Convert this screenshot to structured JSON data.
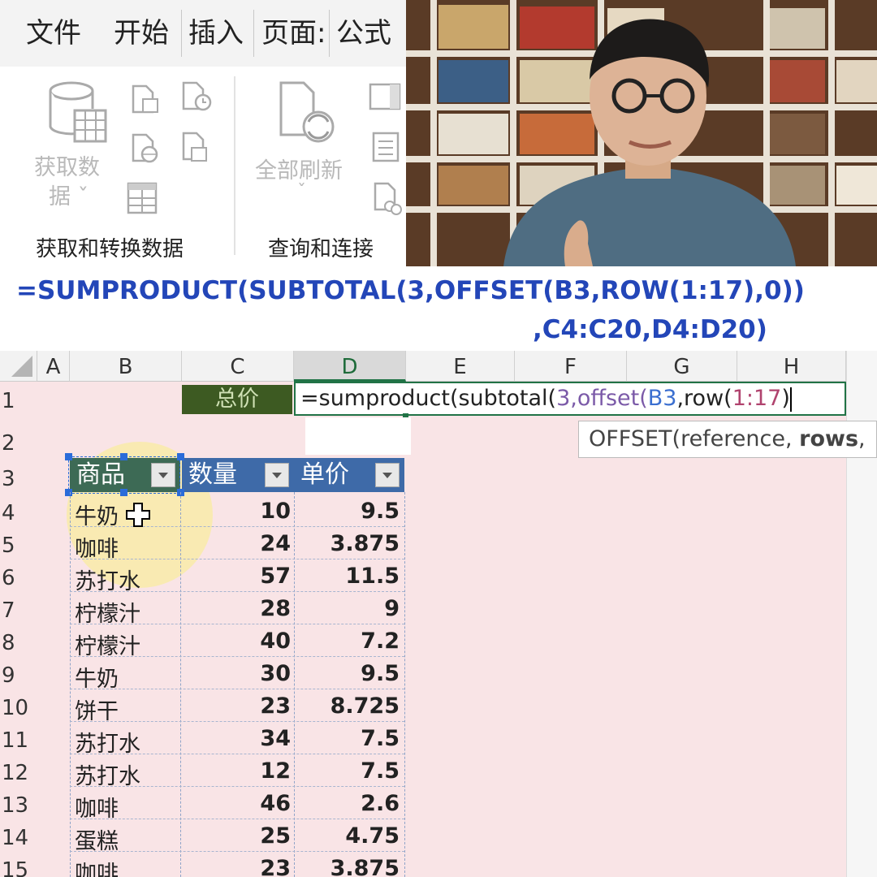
{
  "ribbon": {
    "tabs": [
      "文件",
      "开始",
      "插入",
      "页面:",
      "公式"
    ],
    "get_data_label_1": "获取数",
    "get_data_label_2": "据 ˇ",
    "refresh_all_label": "全部刷新",
    "refresh_all_caret": "ˇ",
    "group_get_transform": "获取和转换数据",
    "group_query_connect": "查询和连接"
  },
  "formula_banner": {
    "line1": "=SUMPRODUCT(SUBTOTAL(3,OFFSET(B3,ROW(1:17),0))",
    "line2": ",C4:C20,D4:D20)"
  },
  "sheet": {
    "columns": [
      "A",
      "B",
      "C",
      "D",
      "E",
      "F",
      "G",
      "H"
    ],
    "active_column": "D",
    "row_numbers": [
      "1",
      "2",
      "3",
      "4",
      "5",
      "6",
      "7",
      "8",
      "9",
      "10",
      "11",
      "12",
      "13",
      "14",
      "15"
    ],
    "c1_label": "总价",
    "editing_formula": {
      "p1": "=sumproduct(subtotal(",
      "p2": "3,offset(",
      "p3": "B3",
      "p4": ",row(",
      "p5": "1:17",
      "p6": ")"
    },
    "tooltip": {
      "fn": "OFFSET(reference, ",
      "arg_bold": "rows",
      "rest": ","
    },
    "table_headers": [
      "商品",
      "数量",
      "单价"
    ],
    "rows": [
      {
        "item": "牛奶",
        "qty": "10",
        "price": "9.5"
      },
      {
        "item": "咖啡",
        "qty": "24",
        "price": "3.875"
      },
      {
        "item": "苏打水",
        "qty": "57",
        "price": "11.5"
      },
      {
        "item": "柠檬汁",
        "qty": "28",
        "price": "9"
      },
      {
        "item": "柠檬汁",
        "qty": "40",
        "price": "7.2"
      },
      {
        "item": "牛奶",
        "qty": "30",
        "price": "9.5"
      },
      {
        "item": "饼干",
        "qty": "23",
        "price": "8.725"
      },
      {
        "item": "苏打水",
        "qty": "34",
        "price": "7.5"
      },
      {
        "item": "苏打水",
        "qty": "12",
        "price": "7.5"
      },
      {
        "item": "咖啡",
        "qty": "46",
        "price": "2.6"
      },
      {
        "item": "蛋糕",
        "qty": "25",
        "price": "4.75"
      },
      {
        "item": "咖啡",
        "qty": "23",
        "price": "3.875"
      }
    ]
  },
  "colors": {
    "header_blue": "#3e6aa8",
    "formula_blue": "#2346b8",
    "label_green": "#3d5a22",
    "sheet_pink": "#f9e4e6"
  }
}
